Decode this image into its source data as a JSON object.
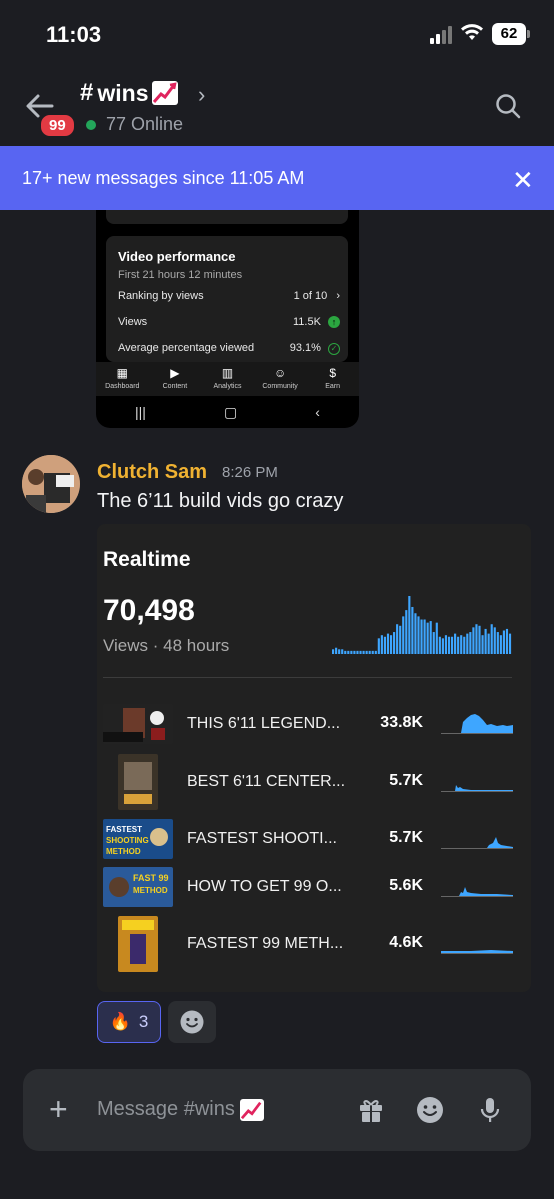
{
  "status_bar": {
    "time": "11:03",
    "battery": "62"
  },
  "header": {
    "unread_badge": "99",
    "channel_hash": "#",
    "channel_name": "wins",
    "online_count": "77 Online"
  },
  "banner": {
    "text": "17+ new messages since 11:05 AM"
  },
  "shared_screenshot": {
    "card_title": "Video performance",
    "card_subtitle": "First 21 hours 12 minutes",
    "rows": [
      {
        "label": "Ranking by views",
        "value": "1 of 10"
      },
      {
        "label": "Views",
        "value": "11.5K"
      },
      {
        "label": "Average percentage viewed",
        "value": "93.1%"
      }
    ],
    "nav": [
      "Dashboard",
      "Content",
      "Analytics",
      "Community",
      "Earn"
    ]
  },
  "message": {
    "author": "Clutch Sam",
    "time": "8:26 PM",
    "text": "The 6’11 build vids go crazy"
  },
  "realtime": {
    "title": "Realtime",
    "views": "70,498",
    "subtitle": "Views · 48 hours",
    "chart_color": "#3ea6ff",
    "videos": [
      {
        "title": "THIS 6'11 LEGEND...",
        "views": "33.8K"
      },
      {
        "title": "BEST 6'11 CENTER...",
        "views": "5.7K"
      },
      {
        "title": "FASTEST SHOOTI...",
        "views": "5.7K"
      },
      {
        "title": "HOW TO GET 99 O...",
        "views": "5.6K"
      },
      {
        "title": "FASTEST 99 METH...",
        "views": "4.6K"
      }
    ]
  },
  "reactions": {
    "fire_count": "3"
  },
  "composer": {
    "placeholder": "Message #wins"
  },
  "chart_data": {
    "type": "bar",
    "title": "",
    "values": [
      3,
      4,
      3,
      3,
      2,
      2,
      2,
      2,
      2,
      2,
      2,
      2,
      2,
      2,
      2,
      10,
      12,
      11,
      13,
      12,
      14,
      19,
      18,
      24,
      28,
      37,
      30,
      26,
      24,
      22,
      22,
      20,
      21,
      14,
      20,
      11,
      10,
      12,
      11,
      11,
      13,
      11,
      12,
      11,
      13,
      14,
      17,
      19,
      18,
      12,
      16,
      13,
      19,
      17,
      14,
      12,
      15,
      16,
      13
    ]
  }
}
